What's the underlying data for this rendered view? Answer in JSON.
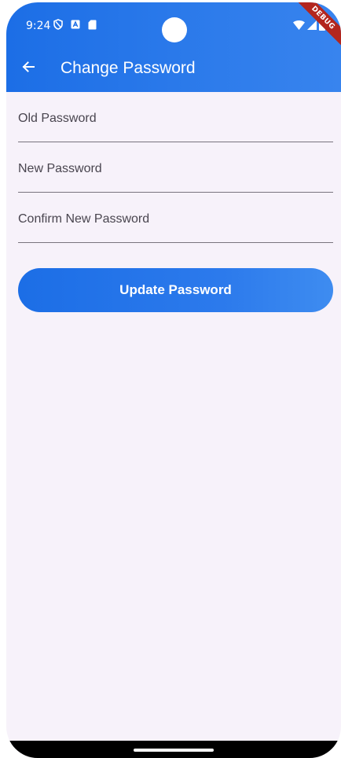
{
  "status_bar": {
    "time": "9:24",
    "left_icons": [
      "shield-icon",
      "a-box-icon",
      "sd-card-icon"
    ],
    "right_icons": [
      "wifi-icon",
      "signal-icon",
      "battery-icon"
    ],
    "debug_label": "DEBUG"
  },
  "app_bar": {
    "back_icon": "arrow-back-icon",
    "title": "Change Password",
    "background": "#1c6ee6"
  },
  "form": {
    "fields": [
      {
        "placeholder": "Old Password",
        "value": ""
      },
      {
        "placeholder": "New Password",
        "value": ""
      },
      {
        "placeholder": "Confirm New Password",
        "value": ""
      }
    ],
    "submit_label": "Update Password"
  },
  "colors": {
    "primary": "#1c6ee6",
    "page_background": "#f7f2fa",
    "underline": "#79747e",
    "label": "#49454f"
  }
}
